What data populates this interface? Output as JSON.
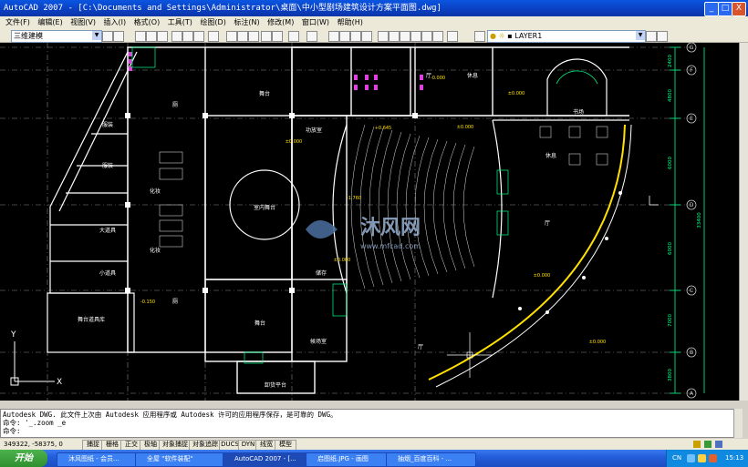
{
  "window": {
    "title": "AutoCAD 2007 - [C:\\Documents and Settings\\Administrator\\桌面\\中小型剧场建筑设计方案平面图.dwg]",
    "min_label": "_",
    "max_label": "□",
    "close_label": "X"
  },
  "menu": {
    "items": [
      "文件(F)",
      "编辑(E)",
      "视图(V)",
      "插入(I)",
      "格式(O)",
      "工具(T)",
      "绘图(D)",
      "标注(N)",
      "修改(M)",
      "窗口(W)",
      "帮助(H)"
    ]
  },
  "toolbar": {
    "workspace_value": "三维建模",
    "layer_value": "LAYER1",
    "dropdown_arrow": "▼"
  },
  "drawing": {
    "axis_bubbles_right": [
      "G",
      "F",
      "E",
      "D",
      "C",
      "B",
      "A"
    ],
    "dims_right": [
      "2400",
      "4800",
      "6000",
      "6000",
      "6000",
      "7000",
      "3800"
    ],
    "dim_total": "33400",
    "room_labels": {
      "r1": "舞台",
      "r2": "休息",
      "r3": "书场",
      "r4": "休息",
      "r5": "功放室",
      "r6": "储存",
      "r7": "服装",
      "r8": "服装",
      "r9": "大道具",
      "r10": "小道具",
      "r11": "舞台道具库",
      "r12": "化妆",
      "r13": "化妆",
      "r14": "室内舞台",
      "r15": "厅",
      "r16": "厅",
      "r17": "舞台",
      "r18": "候场室",
      "r19": "卸货平台",
      "r20": "厅",
      "r21": "厕",
      "r22": "厕"
    },
    "elev_labels": [
      "±0.000",
      "±0.000",
      "+0.645",
      "±0.000",
      "±0.000",
      "-1.760",
      "-0.150",
      "±0.000",
      "-0.000",
      "±0.000"
    ],
    "watermark_text": "沐风网",
    "watermark_url": "www.mfcad.com",
    "ucs_y": "Y",
    "ucs_x": "X"
  },
  "command": {
    "line1": "Autodesk DWG.   此文件上次由 Autodesk 应用程序或 Autodesk 许可的应用程序保存，是可靠的 DWG。",
    "line2": "命令: '_.zoom _e",
    "prompt": "命令:"
  },
  "status": {
    "coords": "349322, -58375, 0",
    "buttons": [
      "捕捉",
      "栅格",
      "正交",
      "极轴",
      "对象捕捉",
      "对象追踪",
      "DUCS",
      "DYN",
      "线宽",
      "模型"
    ]
  },
  "taskbar": {
    "start": "开始",
    "tasks": [
      "沐风图纸 - 会员...",
      "全屋 \"软件装配\"",
      "AutoCAD 2007 - [...",
      "启图纸.JPG - 画图",
      "抽烟_百度百科 - ..."
    ],
    "lang": "CN",
    "time": "15:13"
  }
}
